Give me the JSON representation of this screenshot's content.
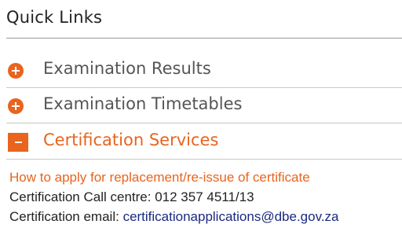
{
  "title": "Quick Links",
  "accordion": [
    {
      "label": "Examination Results",
      "state": "collapsed",
      "icon": "plus-circle-icon"
    },
    {
      "label": "Examination Timetables",
      "state": "collapsed",
      "icon": "plus-circle-icon"
    },
    {
      "label": "Certification Services",
      "state": "expanded",
      "icon": "minus-square-icon"
    }
  ],
  "certification": {
    "link_text": "How to apply for replacement/re-issue of certificate",
    "call_centre_label": "Certification Call centre:",
    "call_centre_number": "012 357 4511/13",
    "email_label": "Certification email:",
    "email": "certificationapplications@dbe.gov.za"
  },
  "colors": {
    "accent": "#e8641f",
    "text": "#222222",
    "muted_label": "#555555",
    "email_link": "#1a2a7e"
  }
}
